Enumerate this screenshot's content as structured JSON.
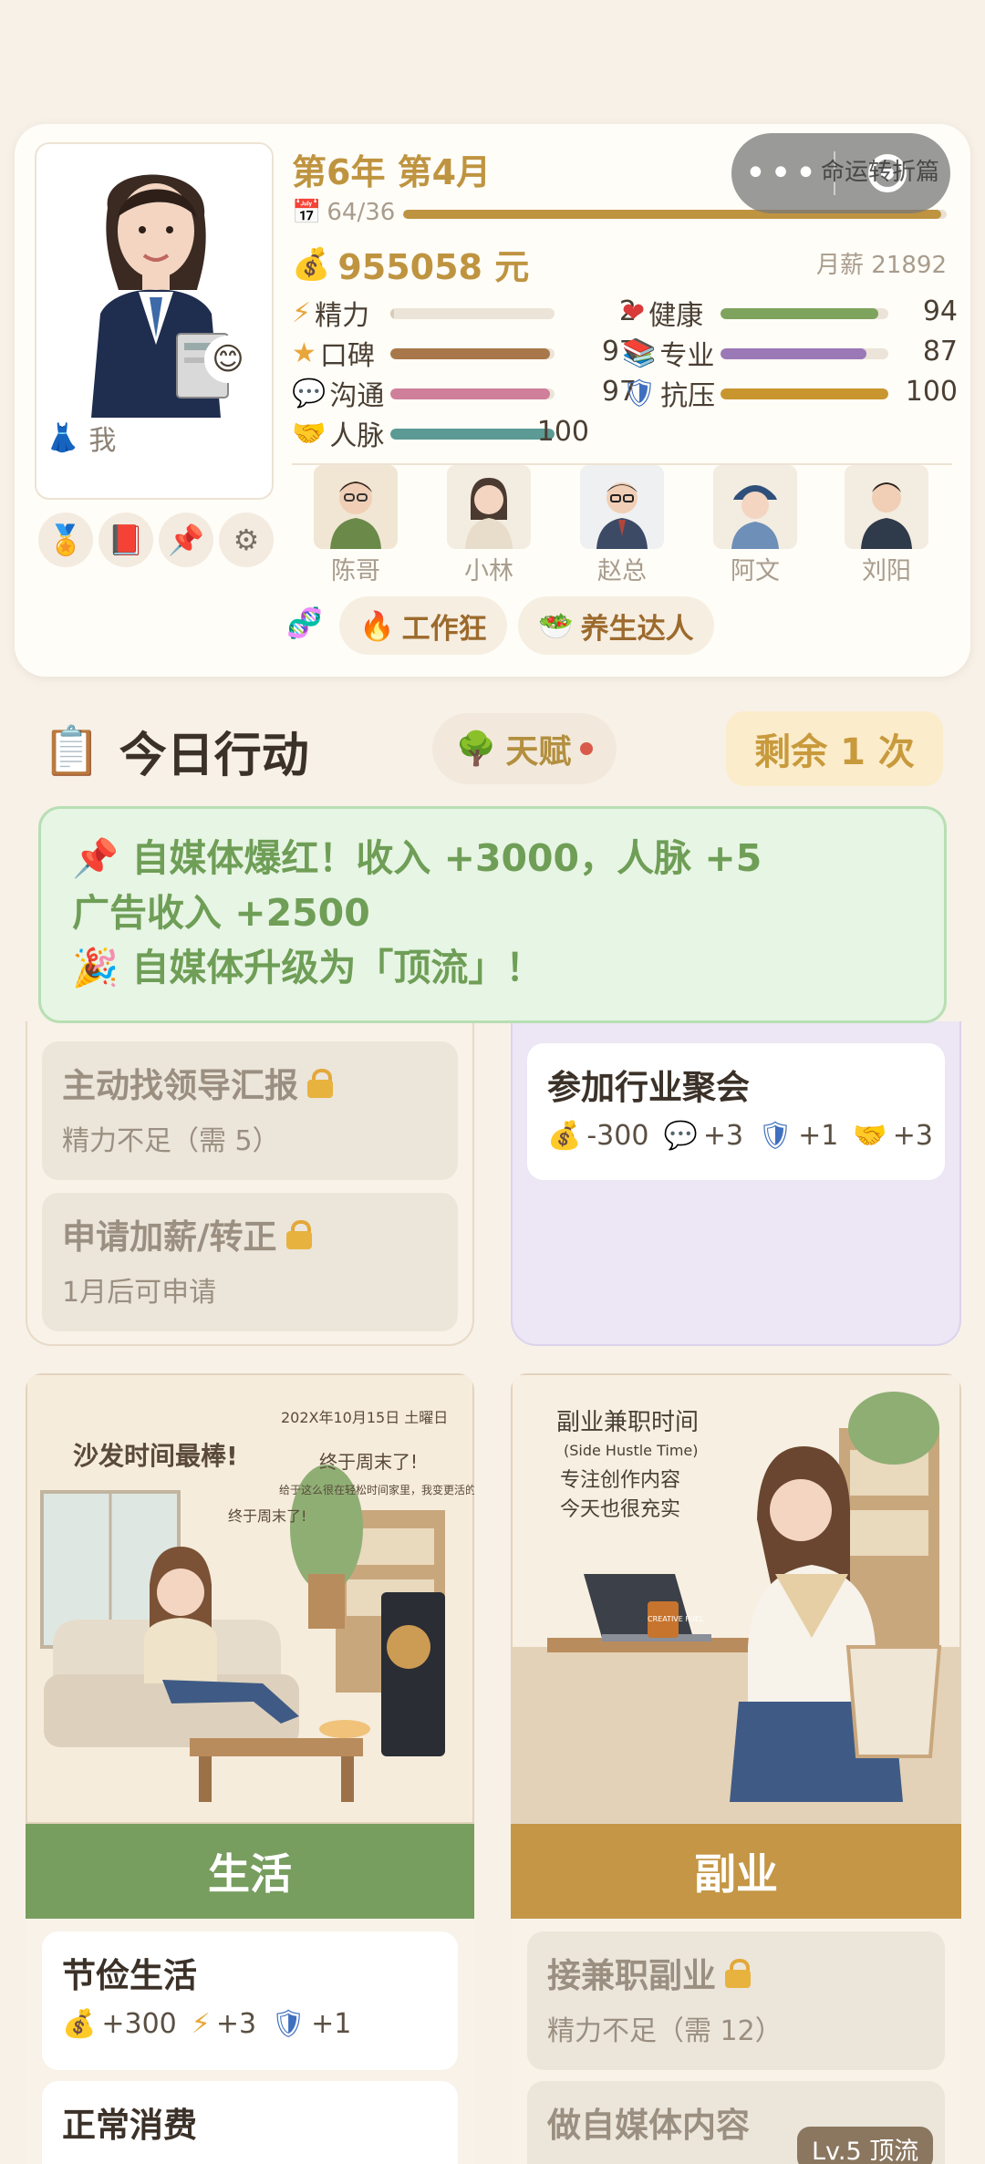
{
  "capsule": {
    "text": "命运转折篇"
  },
  "profile": {
    "name": "我",
    "year_title": "第6年 第4月",
    "day_progress": "64/36",
    "day_progress_fraction": 0.99,
    "money": "955058 元",
    "salary": "月薪 21892",
    "stats": [
      {
        "label": "精力",
        "value": "2",
        "fraction": 0.02,
        "color": "#d8cbb8"
      },
      {
        "label": "健康",
        "value": "94",
        "fraction": 0.94,
        "color": "#7ea35c"
      },
      {
        "label": "口碑",
        "value": "97",
        "fraction": 0.97,
        "color": "#a9784a"
      },
      {
        "label": "专业",
        "value": "87",
        "fraction": 0.87,
        "color": "#9b79b6"
      },
      {
        "label": "沟通",
        "value": "97",
        "fraction": 0.97,
        "color": "#cf7f9a"
      },
      {
        "label": "抗压",
        "value": "100",
        "fraction": 1.0,
        "color": "#c9952f"
      },
      {
        "label": "人脉",
        "value": "100",
        "fraction": 1.0,
        "color": "#5b9a95"
      }
    ],
    "npcs": [
      "陈哥",
      "小林",
      "赵总",
      "阿文",
      "刘阳"
    ],
    "traits": [
      "工作狂",
      "养生达人"
    ]
  },
  "actions": {
    "title": "今日行动",
    "talent_label": "天赋",
    "remaining": "剩余 1 次"
  },
  "toast": {
    "line1": "自媒体爆红！收入 +3000，人脉 +5",
    "line2": "广告收入 +2500",
    "line3": "自媒体升级为「顶流」！"
  },
  "work_col": {
    "items": [
      {
        "title": "主动找领导汇报",
        "sub": "精力不足（需 5）"
      },
      {
        "title": "申请加薪/转正",
        "sub": "1月后可申请"
      }
    ]
  },
  "social_col": {
    "items": [
      {
        "title": "参加行业聚会",
        "effects": [
          "-300",
          "+3",
          "+1",
          "+3"
        ]
      }
    ]
  },
  "life_card": {
    "banner": "生活",
    "art_text": [
      "沙发时间最棒!",
      "202X年10月15日 土曜日",
      "终于周末了!",
      "给于这么很在轻松时间家里，我变更活的啊哦~",
      "终于周末了!"
    ],
    "items": [
      {
        "title": "节俭生活",
        "effects": [
          "+300",
          "+3",
          "+1"
        ]
      },
      {
        "title": "正常消费"
      }
    ]
  },
  "side_card": {
    "banner": "副业",
    "art_text": [
      "副业兼职时间",
      "(Side Hustle Time)",
      "专注创作内容",
      "今天也很充实",
      "CREATIVE FUEL"
    ],
    "items": [
      {
        "title": "接兼职副业",
        "sub": "精力不足（需 12）"
      },
      {
        "title": "做自媒体内容"
      }
    ],
    "badge": "Lv.5 顶流"
  },
  "colors": {
    "gold": "#bf9440",
    "green_banner": "#779d5f",
    "gold_banner": "#c49645",
    "toast_text": "#6f9e57"
  }
}
